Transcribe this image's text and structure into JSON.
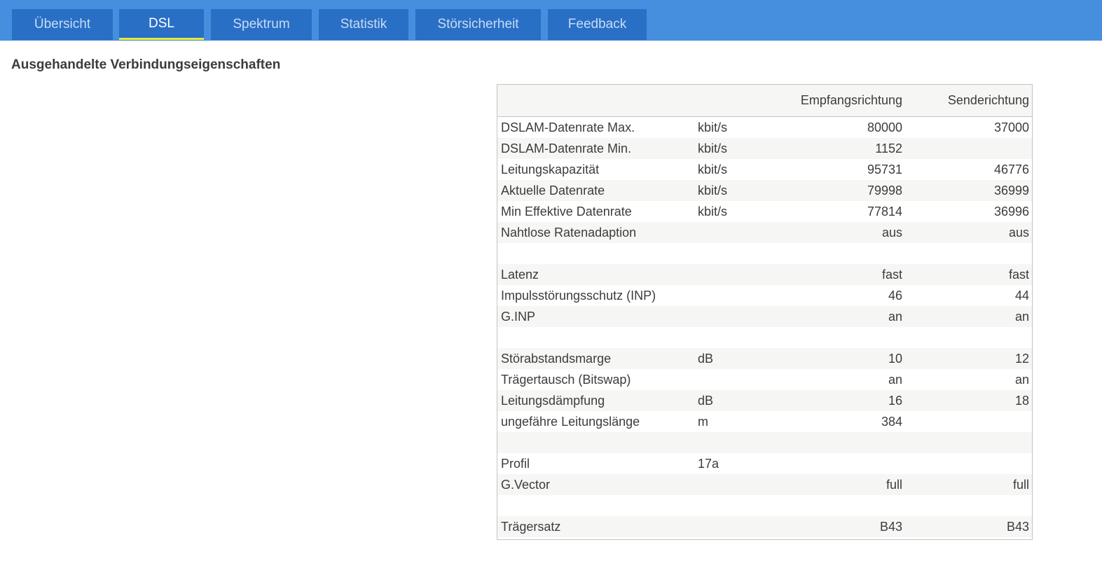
{
  "tabs": [
    {
      "label": "Übersicht",
      "active": false
    },
    {
      "label": "DSL",
      "active": true
    },
    {
      "label": "Spektrum",
      "active": false
    },
    {
      "label": "Statistik",
      "active": false
    },
    {
      "label": "Störsicherheit",
      "active": false
    },
    {
      "label": "Feedback",
      "active": false
    }
  ],
  "colors": {
    "topbar": "#468ede",
    "tab_bg": "#2a6fc6",
    "tab_text": "#c7dcf4",
    "active_underline": "#e6e93c"
  },
  "section_title": "Ausgehandelte Verbindungseigenschaften",
  "table": {
    "headers": {
      "label": "",
      "unit": "",
      "downstream": "Empfangsrichtung",
      "upstream": "Senderichtung"
    },
    "rows": [
      {
        "label": "DSLAM-Datenrate Max.",
        "unit": "kbit/s",
        "down": "80000",
        "up": "37000"
      },
      {
        "label": "DSLAM-Datenrate Min.",
        "unit": "kbit/s",
        "down": "1152",
        "up": ""
      },
      {
        "label": "Leitungskapazität",
        "unit": "kbit/s",
        "down": "95731",
        "up": "46776"
      },
      {
        "label": "Aktuelle Datenrate",
        "unit": "kbit/s",
        "down": "79998",
        "up": "36999"
      },
      {
        "label": "Min Effektive Datenrate",
        "unit": "kbit/s",
        "down": "77814",
        "up": "36996"
      },
      {
        "label": "Nahtlose Ratenadaption",
        "unit": "",
        "down": "aus",
        "up": "aus"
      },
      {
        "label": "",
        "unit": "",
        "down": "",
        "up": ""
      },
      {
        "label": "Latenz",
        "unit": "",
        "down": "fast",
        "up": "fast"
      },
      {
        "label": "Impulsstörungsschutz (INP)",
        "unit": "",
        "down": "46",
        "up": "44"
      },
      {
        "label": "G.INP",
        "unit": "",
        "down": "an",
        "up": "an"
      },
      {
        "label": "",
        "unit": "",
        "down": "",
        "up": ""
      },
      {
        "label": "Störabstandsmarge",
        "unit": "dB",
        "down": "10",
        "up": "12"
      },
      {
        "label": "Trägertausch (Bitswap)",
        "unit": "",
        "down": "an",
        "up": "an"
      },
      {
        "label": "Leitungsdämpfung",
        "unit": "dB",
        "down": "16",
        "up": "18"
      },
      {
        "label": "ungefähre Leitungslänge",
        "unit": "m",
        "down": "384",
        "up": ""
      },
      {
        "label": "",
        "unit": "",
        "down": "",
        "up": ""
      },
      {
        "label": "Profil",
        "unit": "17a",
        "down": "",
        "up": ""
      },
      {
        "label": "G.Vector",
        "unit": "",
        "down": "full",
        "up": "full"
      },
      {
        "label": "",
        "unit": "",
        "down": "",
        "up": ""
      },
      {
        "label": "Trägersatz",
        "unit": "",
        "down": "B43",
        "up": "B43"
      }
    ]
  }
}
